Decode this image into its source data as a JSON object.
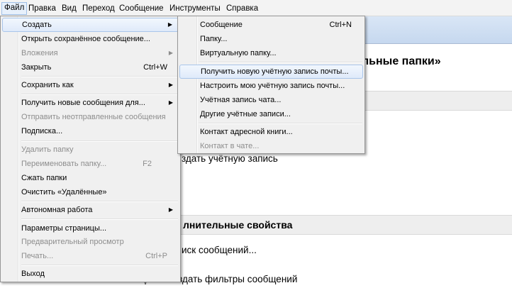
{
  "menubar": [
    {
      "label": "Файл",
      "active": true
    },
    {
      "label": "Правка"
    },
    {
      "label": "Вид"
    },
    {
      "label": "Переход"
    },
    {
      "label": "Сообщение"
    },
    {
      "label": "Инструменты"
    },
    {
      "label": "Справка"
    }
  ],
  "background": {
    "title_fragment": "льные папки»",
    "create_account": "здать учётную запись",
    "section_fragment": "лнительные свойства",
    "search_fragment": "иск сообщений...",
    "filters_fragment": "Создать фильтры сообщений"
  },
  "file_menu": {
    "items": [
      {
        "label": "Создать",
        "arrow": "▶",
        "highlighted": true
      },
      {
        "label": "Открыть сохранённое сообщение..."
      },
      {
        "label": "Вложения",
        "disabled": true,
        "arrow": "▶"
      },
      {
        "label": "Закрыть",
        "shortcut": "Ctrl+W"
      },
      {
        "label": "Сохранить как",
        "arrow": "▶"
      },
      {
        "label": "Получить новые сообщения для...",
        "arrow": "▶"
      },
      {
        "label": "Отправить неотправленные сообщения",
        "disabled": true
      },
      {
        "label": "Подписка..."
      },
      {
        "label": "Удалить папку",
        "disabled": true
      },
      {
        "label": "Переименовать папку...",
        "disabled": true,
        "shortcut": "F2"
      },
      {
        "label": "Сжать папки"
      },
      {
        "label": "Очистить «Удалённые»"
      },
      {
        "label": "Автономная работа",
        "arrow": "▶"
      },
      {
        "label": "Параметры страницы..."
      },
      {
        "label": "Предварительный просмотр",
        "disabled": true
      },
      {
        "label": "Печать...",
        "disabled": true,
        "shortcut": "Ctrl+P"
      },
      {
        "label": "Выход"
      }
    ]
  },
  "create_submenu": {
    "items": [
      {
        "label": "Сообщение",
        "shortcut": "Ctrl+N"
      },
      {
        "label": "Папку..."
      },
      {
        "label": "Виртуальную папку..."
      },
      {
        "label": "Получить новую учётную запись почты...",
        "highlighted": true
      },
      {
        "label": "Настроить мою учётную запись почты..."
      },
      {
        "label": "Учётная запись чата..."
      },
      {
        "label": "Другие учётные записи..."
      },
      {
        "label": "Контакт адресной книги..."
      },
      {
        "label": "Контакт в чате...",
        "disabled": true
      }
    ]
  }
}
